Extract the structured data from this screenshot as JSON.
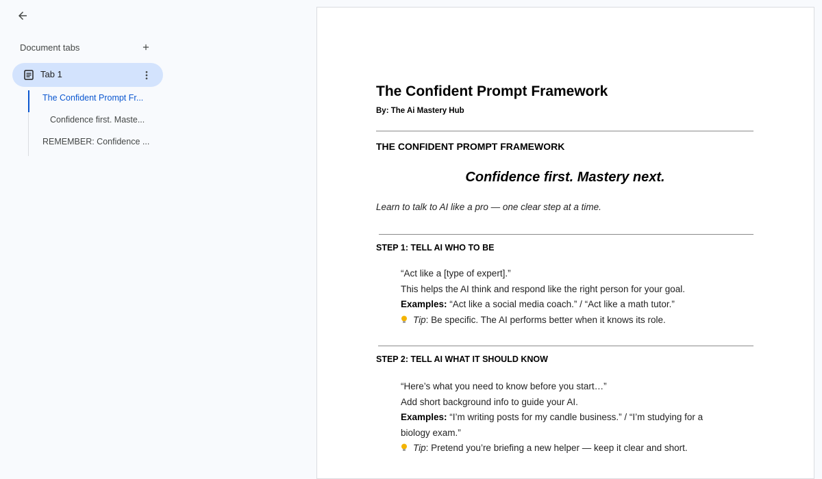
{
  "sidebar": {
    "header_label": "Document tabs",
    "tab": {
      "label": "Tab 1"
    },
    "outline": [
      {
        "label": "The Confident Prompt Fr...",
        "level": 1,
        "active": true
      },
      {
        "label": "Confidence first. Maste...",
        "level": 2,
        "active": false
      },
      {
        "label": "REMEMBER: Confidence ...",
        "level": 1,
        "active": false
      }
    ]
  },
  "document": {
    "title": "The Confident Prompt Framework",
    "byline": "By: The Ai Mastery Hub",
    "section_heading": "THE CONFIDENT PROMPT FRAMEWORK",
    "tagline": "Confidence first. Mastery next.",
    "subtitle": "Learn to talk to AI like a pro — one clear step at a time.",
    "step1": {
      "heading": "STEP 1: TELL AI WHO TO BE",
      "quote": "“Act like a [type of expert].”",
      "description": "This helps the AI think and respond like the right person for your goal.",
      "examples_label": "Examples:",
      "examples_text": " “Act like a social media coach.” / “Act like a math tutor.”",
      "tip_label": "Tip",
      "tip_text": ": Be specific. The AI performs better when it knows its role."
    },
    "step2": {
      "heading": "STEP 2: TELL AI WHAT IT SHOULD KNOW",
      "quote": "“Here’s what you need to know before you start…”",
      "description": "Add short background info to guide your AI.",
      "examples_label": "Examples:",
      "examples_text": " “I’m writing posts for my candle business.” / “I’m studying for a biology exam.”",
      "tip_label": "Tip",
      "tip_text": ": Pretend you’re briefing a new helper — keep it clear and short."
    }
  },
  "colors": {
    "active_tab_bg": "#d3e3fd",
    "accent_blue": "#0b57d0",
    "app_bg": "#f8fafd",
    "tip_bulb": "#f4b400"
  },
  "icons": {
    "back": "arrow-back-icon",
    "add_tab": "plus-icon",
    "tab_doc": "document-icon",
    "tab_menu": "more-vert-icon",
    "tip": "lightbulb-icon"
  }
}
